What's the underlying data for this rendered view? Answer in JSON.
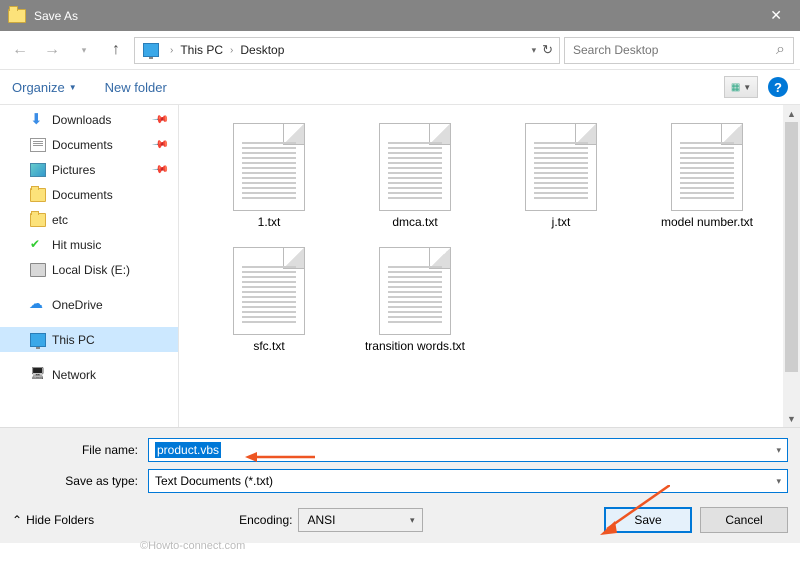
{
  "window": {
    "title": "Save As"
  },
  "breadcrumb": {
    "root": "This PC",
    "leaf": "Desktop"
  },
  "search": {
    "placeholder": "Search Desktop"
  },
  "toolbar": {
    "organize": "Organize",
    "newfolder": "New folder"
  },
  "sidebar": [
    {
      "name": "downloads",
      "label": "Downloads",
      "icon": "dl",
      "pin": true
    },
    {
      "name": "documents",
      "label": "Documents",
      "icon": "doc",
      "pin": true
    },
    {
      "name": "pictures",
      "label": "Pictures",
      "icon": "pic",
      "pin": true
    },
    {
      "name": "documents2",
      "label": "Documents",
      "icon": "folder"
    },
    {
      "name": "etc",
      "label": "etc",
      "icon": "folder"
    },
    {
      "name": "hitmusic",
      "label": "Hit music",
      "icon": "music"
    },
    {
      "name": "localdisk",
      "label": "Local Disk (E:)",
      "icon": "disk"
    },
    {
      "name": "spacer",
      "spacer": true
    },
    {
      "name": "onedrive",
      "label": "OneDrive",
      "icon": "onedrive"
    },
    {
      "name": "spacer2",
      "spacer": true
    },
    {
      "name": "thispc",
      "label": "This PC",
      "icon": "pc",
      "selected": true
    },
    {
      "name": "spacer3",
      "spacer": true
    },
    {
      "name": "network",
      "label": "Network",
      "icon": "net"
    }
  ],
  "files": [
    {
      "name": "1.txt"
    },
    {
      "name": "dmca.txt"
    },
    {
      "name": "j.txt"
    },
    {
      "name": "model number.txt"
    },
    {
      "name": "sfc.txt"
    },
    {
      "name": "transition words.txt"
    }
  ],
  "form": {
    "filename_label": "File name:",
    "filename_value": "product.vbs",
    "type_label": "Save as type:",
    "type_value": "Text Documents (*.txt)",
    "encoding_label": "Encoding:",
    "encoding_value": "ANSI",
    "hide_folders": "Hide Folders",
    "save": "Save",
    "cancel": "Cancel"
  },
  "watermark": "©Howto-connect.com"
}
